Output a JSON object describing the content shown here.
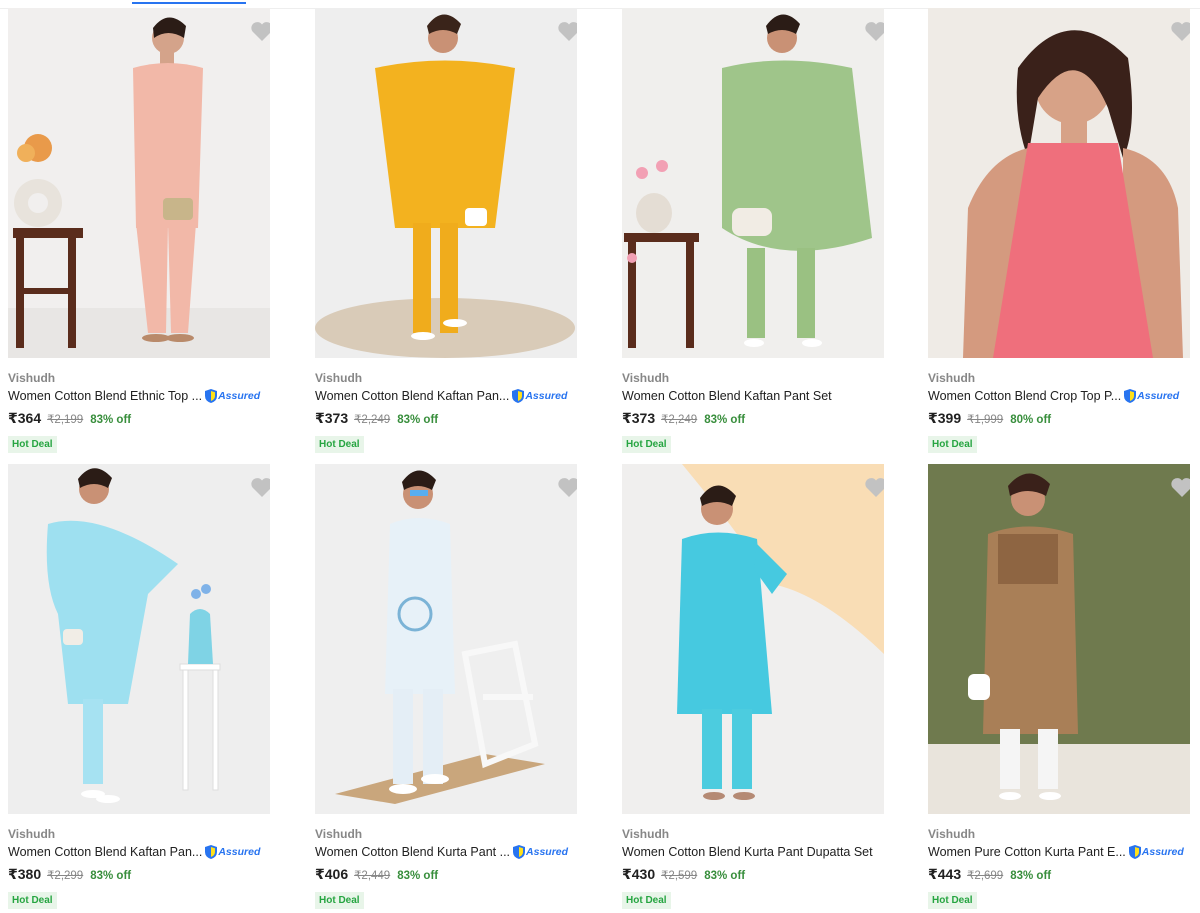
{
  "header": {
    "partial_text": "· · · ·"
  },
  "products": [
    {
      "brand": "Vishudh",
      "title": "Women Cotton Blend Ethnic Top ...",
      "assured": true,
      "assured_label": "Assured",
      "price": "₹364",
      "mrp": "₹2,199",
      "discount": "83% off",
      "badge": "Hot Deal"
    },
    {
      "brand": "Vishudh",
      "title": "Women Cotton Blend Kaftan Pan...",
      "assured": true,
      "assured_label": "Assured",
      "price": "₹373",
      "mrp": "₹2,249",
      "discount": "83% off",
      "badge": "Hot Deal"
    },
    {
      "brand": "Vishudh",
      "title": "Women Cotton Blend Kaftan Pant Set",
      "assured": false,
      "assured_label": "",
      "price": "₹373",
      "mrp": "₹2,249",
      "discount": "83% off",
      "badge": "Hot Deal"
    },
    {
      "brand": "Vishudh",
      "title": "Women Cotton Blend Crop Top P...",
      "assured": true,
      "assured_label": "Assured",
      "price": "₹399",
      "mrp": "₹1,999",
      "discount": "80% off",
      "badge": "Hot Deal"
    },
    {
      "brand": "Vishudh",
      "title": "Women Cotton Blend Kaftan Pan...",
      "assured": true,
      "assured_label": "Assured",
      "price": "₹380",
      "mrp": "₹2,299",
      "discount": "83% off",
      "badge": "Hot Deal"
    },
    {
      "brand": "Vishudh",
      "title": "Women Cotton Blend Kurta Pant ...",
      "assured": true,
      "assured_label": "Assured",
      "price": "₹406",
      "mrp": "₹2,449",
      "discount": "83% off",
      "badge": "Hot Deal"
    },
    {
      "brand": "Vishudh",
      "title": "Women Cotton Blend Kurta Pant Dupatta Set",
      "assured": false,
      "assured_label": "",
      "price": "₹430",
      "mrp": "₹2,599",
      "discount": "83% off",
      "badge": "Hot Deal"
    },
    {
      "brand": "Vishudh",
      "title": "Women Pure Cotton Kurta Pant E...",
      "assured": true,
      "assured_label": "Assured",
      "price": "₹443",
      "mrp": "₹2,699",
      "discount": "83% off",
      "badge": "Hot Deal"
    }
  ],
  "colors": {
    "accent": "#2874f0",
    "discount": "#388e3c",
    "badge_bg": "#e8f5e9",
    "heart": "#c2c2c2"
  },
  "icons": {
    "wishlist": "heart-icon",
    "assured": "assured-shield-icon"
  }
}
